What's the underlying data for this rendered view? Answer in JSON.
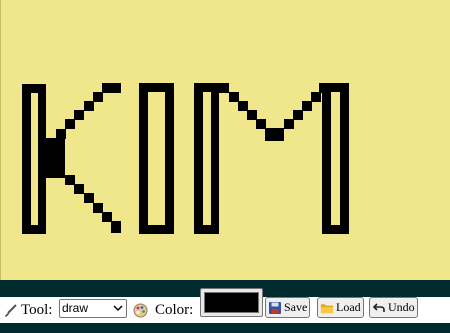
{
  "canvas": {
    "background": "#f0e68c",
    "pen_color": "#000000",
    "drawing_text": "KIM"
  },
  "toolbar": {
    "tool_icon": "paintbrush-icon",
    "tool_label": "Tool:",
    "tool_value": "draw",
    "color_icon": "palette-icon",
    "color_label": "Color:",
    "color_value": "#000000",
    "save_icon": "floppy-disk-icon",
    "save_label": "Save",
    "load_icon": "folder-icon",
    "load_label": "Load",
    "undo_icon": "undo-arrow-icon",
    "undo_label": "Undo"
  }
}
